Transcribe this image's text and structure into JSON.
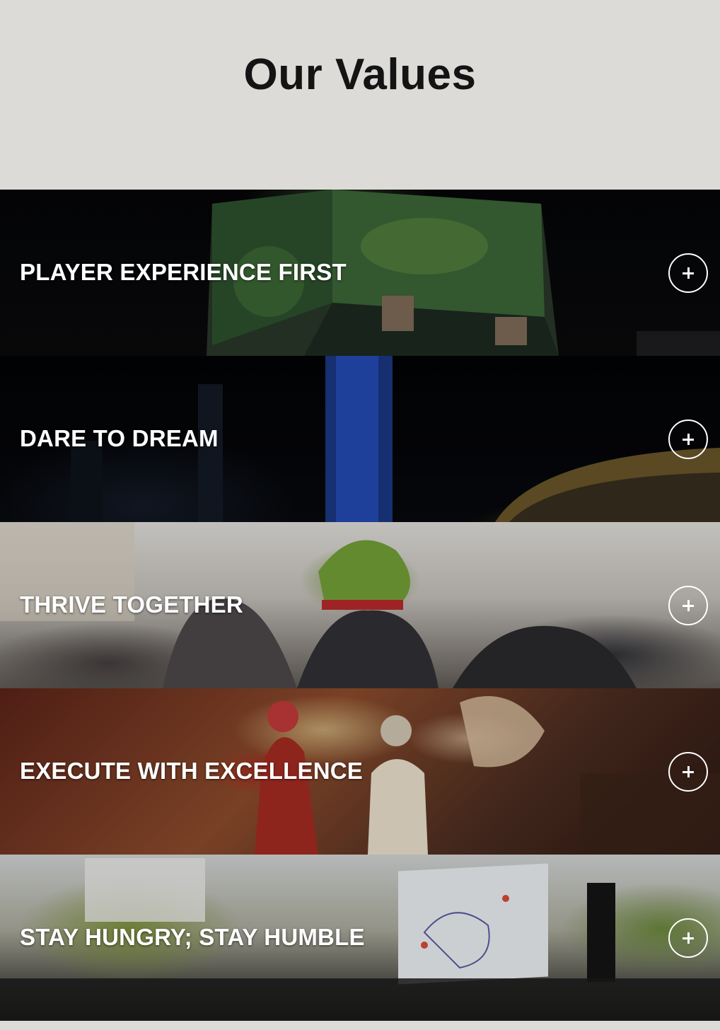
{
  "header": {
    "title": "Our Values"
  },
  "values": [
    {
      "label": "PLAYER EXPERIENCE FIRST"
    },
    {
      "label": "DARE TO DREAM"
    },
    {
      "label": "THRIVE TOGETHER"
    },
    {
      "label": "EXECUTE WITH EXCELLENCE"
    },
    {
      "label": "STAY HUNGRY; STAY HUMBLE"
    }
  ],
  "icons": {
    "toggle": "plus-icon"
  }
}
